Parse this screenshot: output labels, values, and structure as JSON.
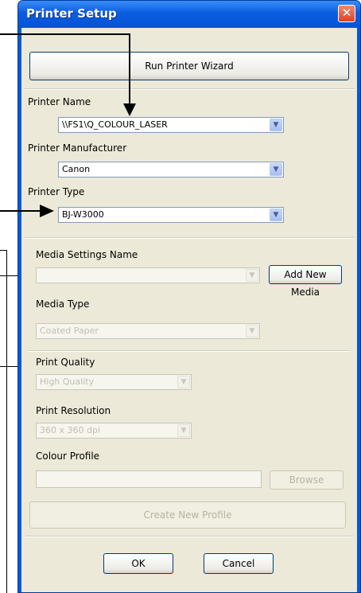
{
  "window": {
    "title": "Printer Setup",
    "close_glyph": "✕"
  },
  "wizard_button": "Run Printer Wizard",
  "printer_name": {
    "label": "Printer Name",
    "value": "\\\\FS1\\Q_COLOUR_LASER"
  },
  "printer_manufacturer": {
    "label": "Printer Manufacturer",
    "value": "Canon"
  },
  "printer_type": {
    "label": "Printer Type",
    "value": "BJ-W3000"
  },
  "media_settings": {
    "label": "Media Settings Name",
    "value": "",
    "add_button": "Add New Media"
  },
  "media_type": {
    "label": "Media Type",
    "value": "Coated Paper"
  },
  "print_quality": {
    "label": "Print Quality",
    "value": "High Quality"
  },
  "print_resolution": {
    "label": "Print Resolution",
    "value": "360 x 360 dpi"
  },
  "colour_profile": {
    "label": "Colour Profile",
    "value": "",
    "browse_button": "Browse"
  },
  "create_profile_button": "Create New Profile",
  "ok_button": "OK",
  "cancel_button": "Cancel",
  "dropdown_glyph": "▼",
  "colors": {
    "title_bar": "#0a5ce0",
    "dialog_bg": "#ece9d8",
    "close_button": "#d9432a"
  }
}
